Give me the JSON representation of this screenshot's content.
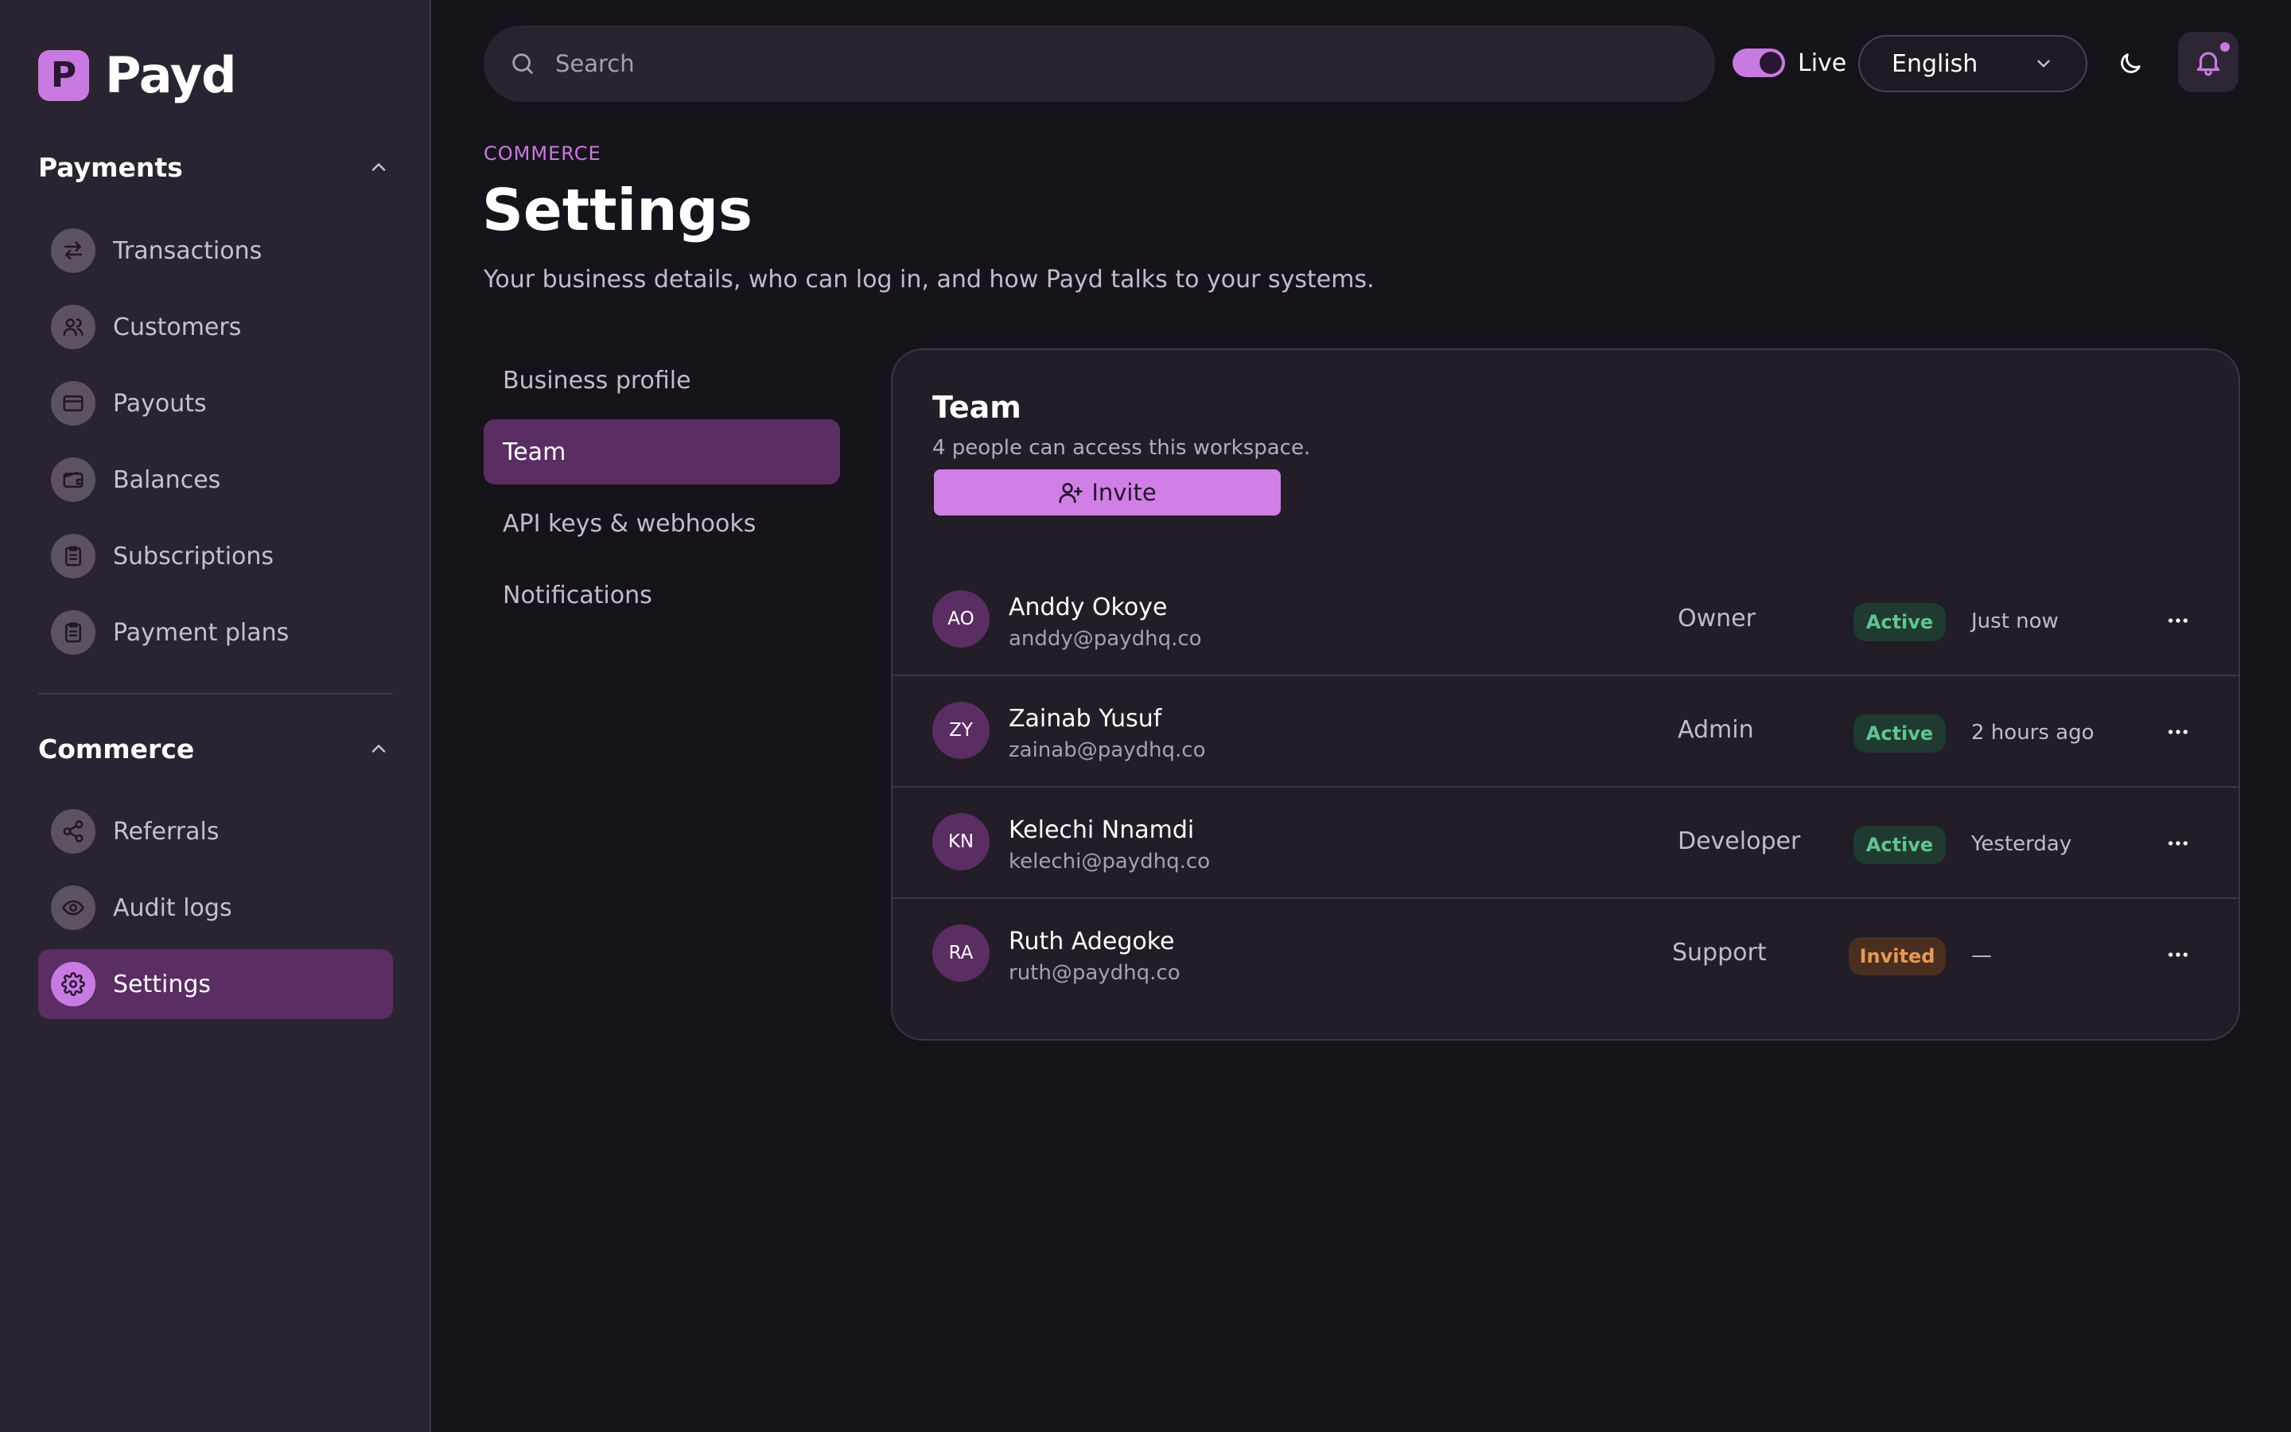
{
  "brand": {
    "mark": "P",
    "name": "Payd"
  },
  "sidebar": {
    "sections": [
      {
        "title": "Payments",
        "items": [
          {
            "label": "Transactions",
            "icon": "arrows-swap-icon"
          },
          {
            "label": "Customers",
            "icon": "users-icon"
          },
          {
            "label": "Payouts",
            "icon": "credit-card-icon"
          },
          {
            "label": "Balances",
            "icon": "wallet-icon"
          },
          {
            "label": "Subscriptions",
            "icon": "clipboard-icon"
          },
          {
            "label": "Payment plans",
            "icon": "clipboard-icon"
          }
        ]
      },
      {
        "title": "Commerce",
        "items": [
          {
            "label": "Referrals",
            "icon": "share-icon"
          },
          {
            "label": "Audit logs",
            "icon": "eye-icon"
          },
          {
            "label": "Settings",
            "icon": "gear-icon",
            "active": true
          }
        ]
      }
    ]
  },
  "topbar": {
    "search_placeholder": "Search",
    "live_label": "Live",
    "live_on": true,
    "language": "English"
  },
  "page": {
    "eyebrow": "COMMERCE",
    "title": "Settings",
    "subtitle": "Your business details, who can log in, and how Payd talks to your systems."
  },
  "settings_nav": [
    {
      "label": "Business profile"
    },
    {
      "label": "Team",
      "active": true
    },
    {
      "label": "API keys & webhooks"
    },
    {
      "label": "Notifications"
    }
  ],
  "team": {
    "title": "Team",
    "subtitle": "4 people can access this workspace.",
    "invite_label": "Invite",
    "members": [
      {
        "initials": "AO",
        "name": "Anddy Okoye",
        "email": "anddy@paydhq.co",
        "role": "Owner",
        "status": "Active",
        "last_seen": "Just now"
      },
      {
        "initials": "ZY",
        "name": "Zainab Yusuf",
        "email": "zainab@paydhq.co",
        "role": "Admin",
        "status": "Active",
        "last_seen": "2 hours ago"
      },
      {
        "initials": "KN",
        "name": "Kelechi Nnamdi",
        "email": "kelechi@paydhq.co",
        "role": "Developer",
        "status": "Active",
        "last_seen": "Yesterday"
      },
      {
        "initials": "RA",
        "name": "Ruth Adegoke",
        "email": "ruth@paydhq.co",
        "role": "Support",
        "status": "Invited",
        "last_seen": "—"
      }
    ]
  },
  "colors": {
    "accent": "#c97ae0",
    "sidebar_bg": "#2a2331",
    "page_bg": "#17131b",
    "active_nav_bg": "#5a2d63",
    "status_active": "#5fc58e",
    "status_invited": "#e69a54"
  }
}
